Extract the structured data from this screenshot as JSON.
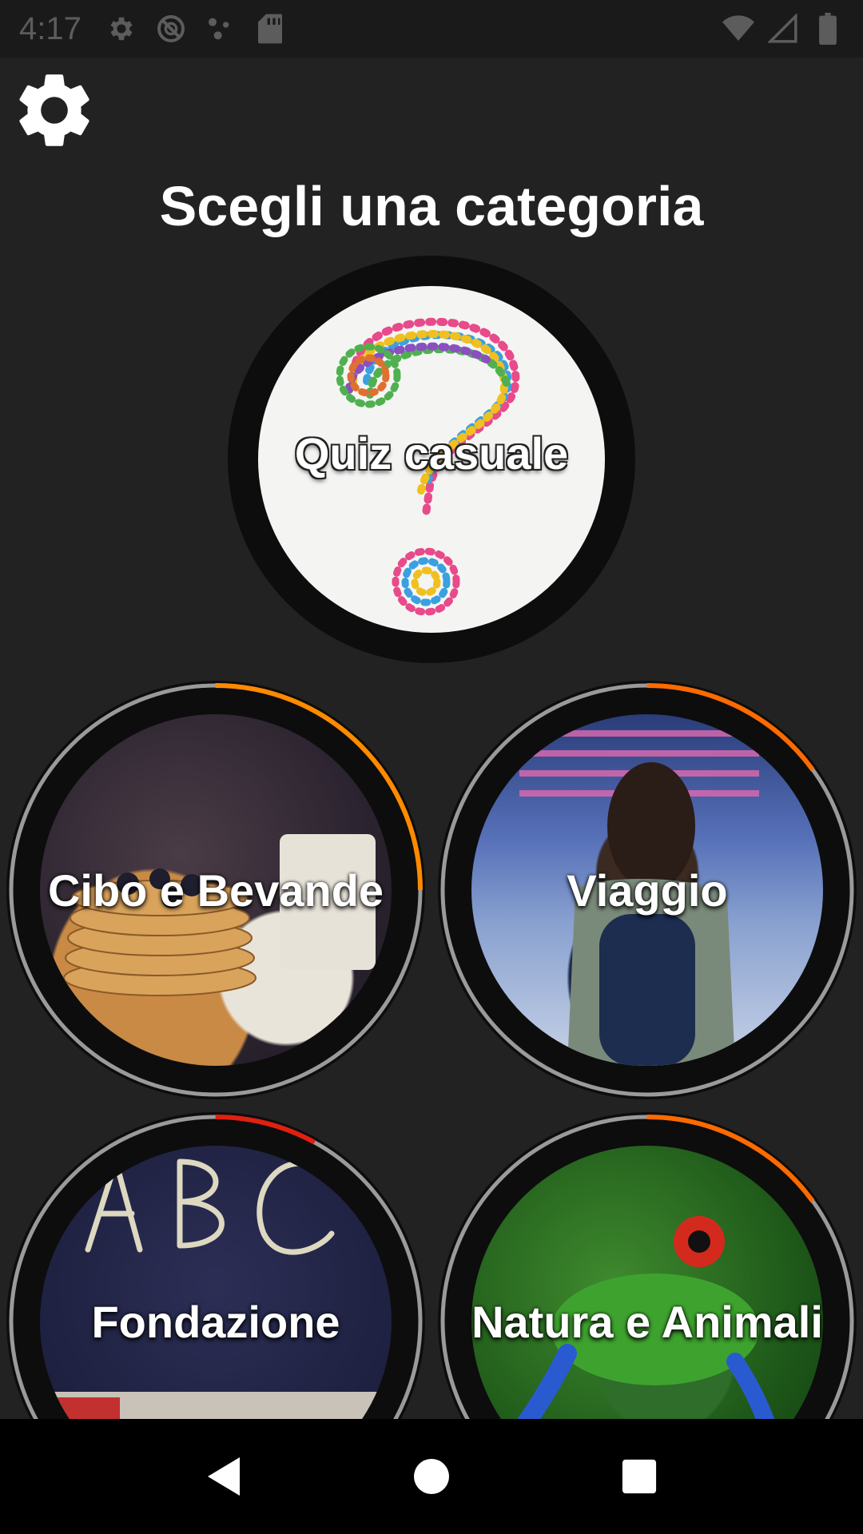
{
  "status_bar": {
    "time": "4:17",
    "icons_left": [
      "gear-icon",
      "sync-off-icon",
      "dots-icon",
      "sd-card-icon"
    ],
    "icons_right": [
      "wifi-icon",
      "signal-icon",
      "battery-icon"
    ]
  },
  "header": {
    "settings_icon": "gear-icon",
    "title": "Scegli una categoria"
  },
  "categories": [
    {
      "label": "Quiz casuale",
      "progress": 0
    },
    {
      "label": "Cibo e Bevande",
      "progress": 0.25,
      "accent": "#ff8a00"
    },
    {
      "label": "Viaggio",
      "progress": 0.15,
      "accent": "#ff6a00"
    },
    {
      "label": "Fondazione",
      "progress": 0.08,
      "accent": "#e02010"
    },
    {
      "label": "Natura e Animali",
      "progress": 0.15,
      "accent": "#ff6a00"
    }
  ],
  "nav_bar": {
    "buttons": [
      "back-icon",
      "home-icon",
      "recents-icon"
    ]
  },
  "colors": {
    "background": "#222222",
    "ring_track": "#9a9a9a",
    "ring_dark": "#0d0d0d"
  }
}
